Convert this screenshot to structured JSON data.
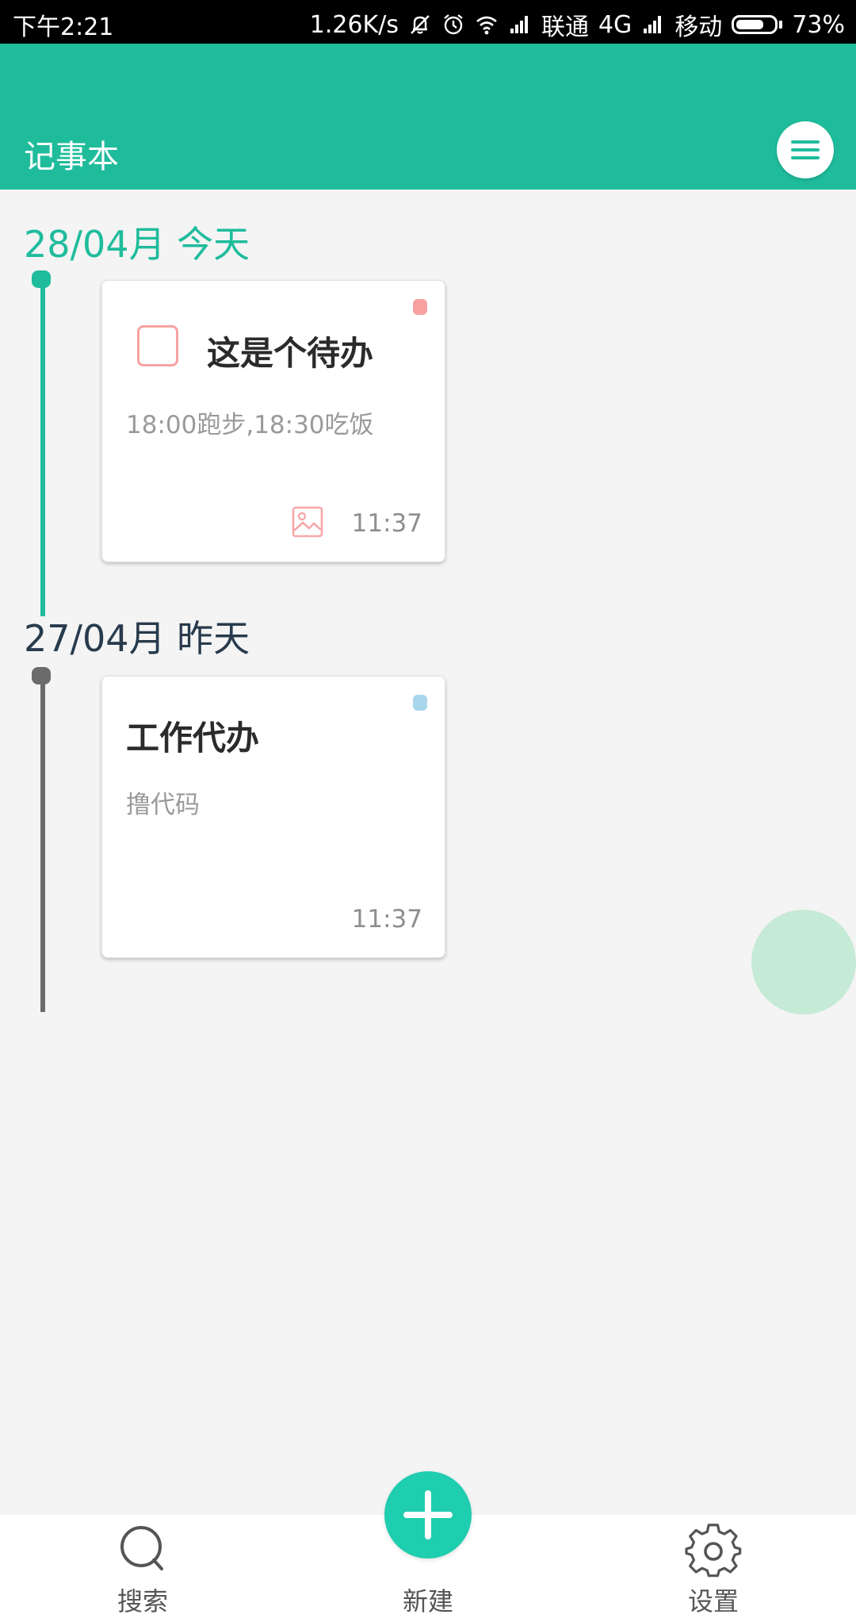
{
  "status_bar": {
    "time": "下午2:21",
    "net_speed": "1.26K/s",
    "carrier1": "联通",
    "network1": "4G",
    "carrier2": "移动",
    "battery_percent": "73%",
    "battery_level": 0.73,
    "icons": [
      "mute-icon",
      "alarm-icon",
      "wifi-icon",
      "signal-icon",
      "signal-icon",
      "battery-icon"
    ]
  },
  "app_bar": {
    "title": "记事本",
    "menu_icon": "menu-icon",
    "color": "#1fbc9c"
  },
  "timeline": {
    "groups": [
      {
        "date": "28/04月 今天",
        "color": "#1fbc9c",
        "notes": [
          {
            "type": "todo",
            "title": "这是个待办",
            "content": "18:00跑步,18:30吃饭",
            "time": "11:37",
            "tag_color": "#f7a0a0",
            "has_image": true
          }
        ]
      },
      {
        "date": "27/04月 昨天",
        "color": "#6b6b6b",
        "notes": [
          {
            "type": "note",
            "title": "工作代办",
            "content": "撸代码",
            "time": "11:37",
            "tag_color": "#a8d6ec",
            "has_image": false
          }
        ]
      }
    ]
  },
  "bottom_nav": {
    "search_label": "搜索",
    "new_label": "新建",
    "settings_label": "设置",
    "accent": "#1fcdaf"
  }
}
